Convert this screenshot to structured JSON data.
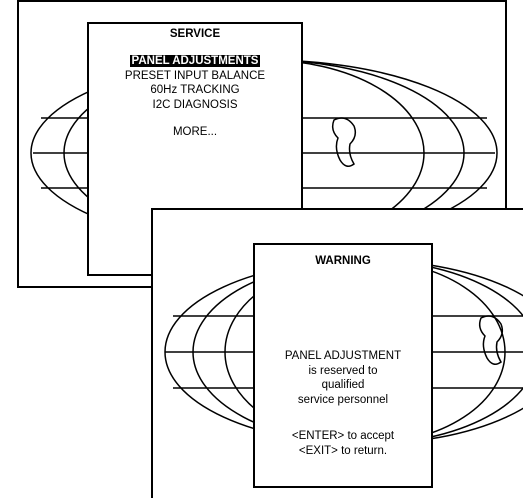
{
  "service_screen": {
    "title": "SERVICE",
    "items": [
      {
        "label": "PANEL ADJUSTMENTS",
        "selected": true
      },
      {
        "label": "PRESET INPUT BALANCE",
        "selected": false
      },
      {
        "label": "60Hz TRACKING",
        "selected": false
      },
      {
        "label": "I2C DIAGNOSIS",
        "selected": false
      }
    ],
    "more_label": "MORE..."
  },
  "warning_screen": {
    "title": "WARNING",
    "message_lines": [
      "PANEL ADJUSTMENT",
      "is reserved to",
      "qualified",
      "service personnel"
    ],
    "instruction_lines": [
      "<ENTER> to accept",
      "<EXIT> to return."
    ]
  },
  "icons": {
    "background": "globe-icon"
  },
  "colors": {
    "background": "#ffffff",
    "foreground": "#000000",
    "highlight_bg": "#000000",
    "highlight_fg": "#ffffff"
  }
}
